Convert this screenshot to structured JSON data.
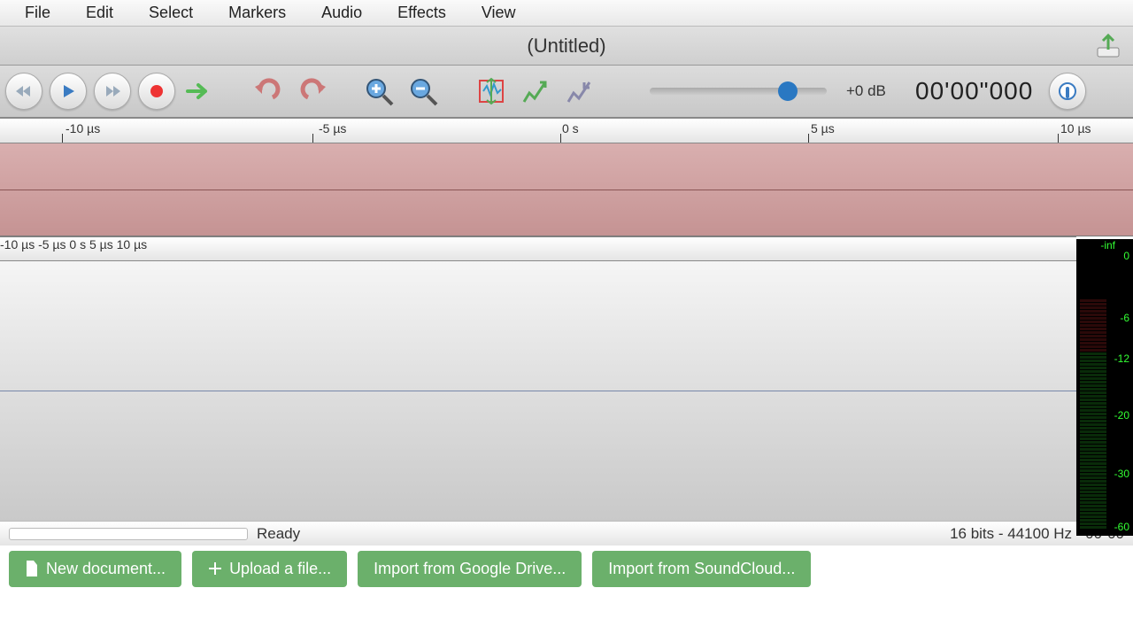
{
  "menu": {
    "items": [
      "File",
      "Edit",
      "Select",
      "Markers",
      "Audio",
      "Effects",
      "View"
    ]
  },
  "title": "(Untitled)",
  "toolbar": {
    "db_label": "+0 dB",
    "timecode": "00'00\"000"
  },
  "ruler1": {
    "ticks": [
      "-10 µs",
      "-5 µs",
      "0 s",
      "5 µs",
      "10 µs"
    ]
  },
  "ruler2": {
    "ticks": [
      "-10 µs",
      "-5 µs",
      "0 s",
      "5 µs",
      "10 µs"
    ]
  },
  "meter": {
    "top": "-inf",
    "labels": [
      "0",
      "-6",
      "-12",
      "-20",
      "-30",
      "-60"
    ]
  },
  "status": {
    "text": "Ready",
    "right": "16 bits - 44100 Hz - 00\"00"
  },
  "actions": {
    "new_doc": "New document...",
    "upload": "Upload a file...",
    "gdrive": "Import from Google Drive...",
    "soundcloud": "Import from SoundCloud..."
  }
}
